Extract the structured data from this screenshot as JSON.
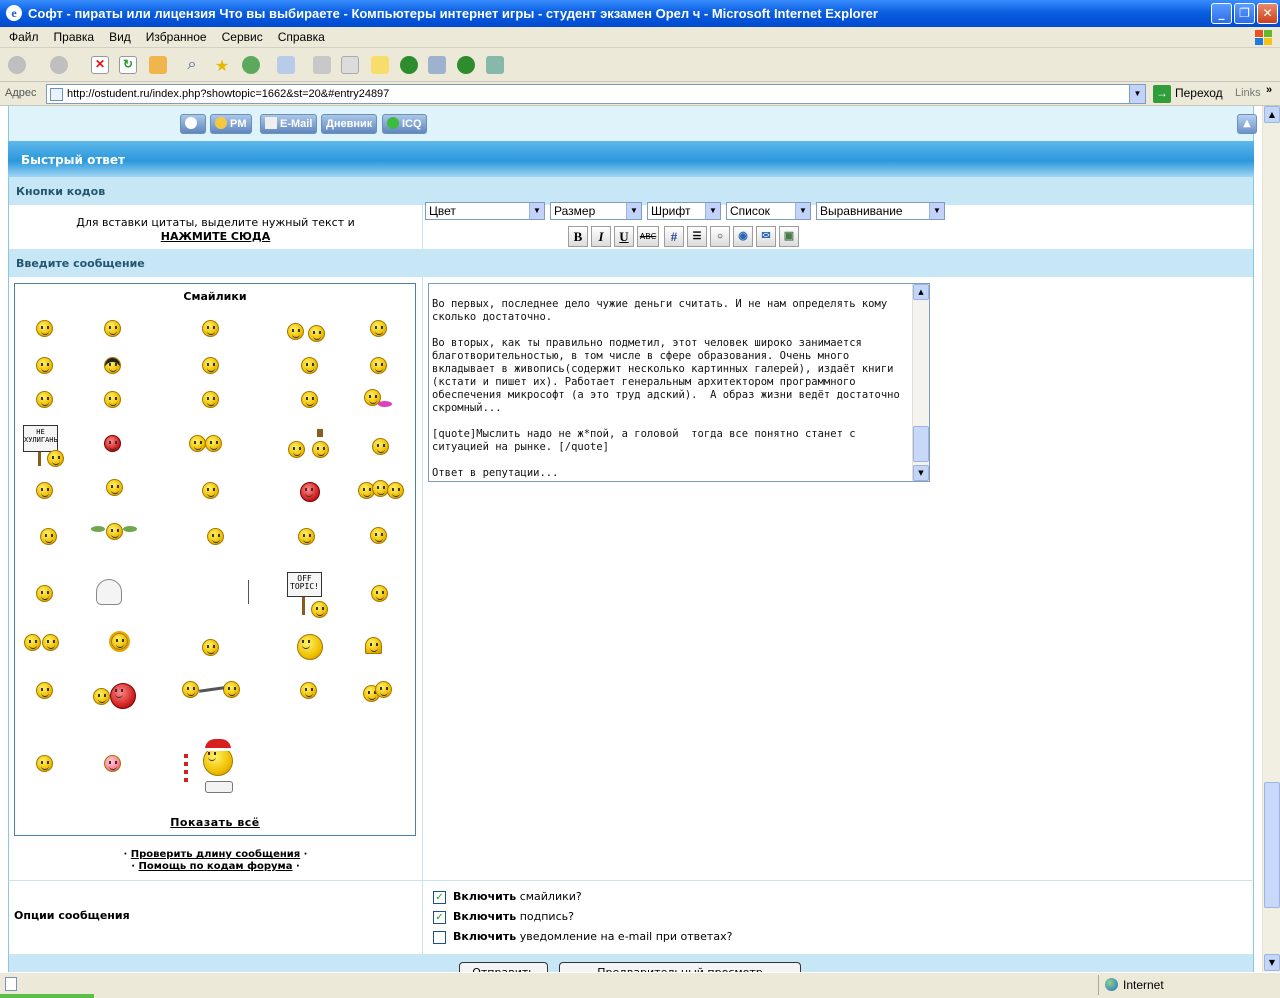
{
  "window": {
    "title": "Софт - пираты или лицензия Что вы выбираете - Компьютеры интернет игры - студент экзамен Орел ч - Microsoft Internet Explorer"
  },
  "menu": [
    "Файл",
    "Правка",
    "Вид",
    "Избранное",
    "Сервис",
    "Справка"
  ],
  "address": {
    "label": "Адрес",
    "url": "http://ostudent.ru/index.php?showtopic=1662&st=20&#entry24897",
    "go": "Переход",
    "links": "Links"
  },
  "profile_buttons": [
    "PM",
    "E-Mail",
    "Дневник",
    "ICQ"
  ],
  "quick_reply": {
    "header": "Быстрый ответ",
    "code_buttons_label": "Кнопки кодов",
    "quote_hint": "Для вставки цитаты, выделите нужный текст и",
    "quote_link": "НАЖМИТЕ СЮДА",
    "selects": [
      "Цвет",
      "Размер",
      "Шрифт",
      "Список",
      "Выравнивание"
    ],
    "format_buttons": [
      "B",
      "I",
      "U",
      "ABC",
      "#"
    ],
    "enter_message_label": "Введите сообщение",
    "smilies_title": "Смайлики",
    "sign_hooligan": "НЕ ХУЛИГАНЬ",
    "sign_offtopic": "OFF TOPIC!",
    "show_all": "Показать всё",
    "help_links": [
      "Проверить длину сообщения",
      "Помощь по кодам форума"
    ],
    "message_text": "Во первых, последнее дело чужие деньги считать. И не нам определять кому сколько достаточно.\n\nВо вторых, как ты правильно подметил, этот человек широко занимается благотворительностью, в том числе в сфере образования. Очень много вкладывает в живопись(содержит несколько картинных галерей), издаёт книги (кстати и пишет их). Работает генеральным архитектором программного обеспечения микрософт (а это труд адский).  А образ жизни ведёт достаточно скромный...\n\n[quote]Мыслить надо не ж*пой, а головой  тогда все понятно станет с ситуацией на рынке. [/quote]\n\nОтвет в репутации...",
    "options_label": "Опции сообщения",
    "options": [
      {
        "bold": "Включить",
        "text": " смайлики?",
        "checked": true
      },
      {
        "bold": "Включить",
        "text": " подпись?",
        "checked": true
      },
      {
        "bold": "Включить",
        "text": " уведомление на e-mail при ответах?",
        "checked": false
      }
    ],
    "submit_buttons": [
      "Отправить",
      "Предварительный просмотр"
    ]
  },
  "status": {
    "zone": "Internet"
  }
}
